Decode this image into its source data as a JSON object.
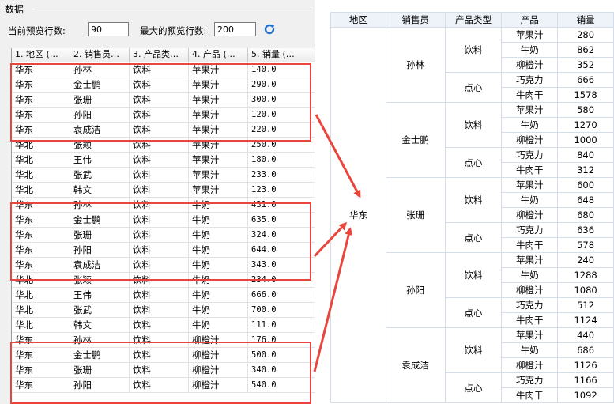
{
  "panel": {
    "title": "数据",
    "current_preview_label": "当前预览行数:",
    "current_preview_value": "90",
    "max_preview_label": "最大的预览行数:",
    "max_preview_value": "200",
    "refresh_icon": "refresh-icon",
    "headers": [
      "1. 地区 (…",
      "2. 销售员…",
      "3. 产品类…",
      "4. 产品 (…",
      "5. 销量 (…"
    ],
    "rows": [
      [
        "华东",
        "孙林",
        "饮料",
        "苹果汁",
        "140.0"
      ],
      [
        "华东",
        "金士鹏",
        "饮料",
        "苹果汁",
        "290.0"
      ],
      [
        "华东",
        "张珊",
        "饮料",
        "苹果汁",
        "300.0"
      ],
      [
        "华东",
        "孙阳",
        "饮料",
        "苹果汁",
        "120.0"
      ],
      [
        "华东",
        "袁成洁",
        "饮料",
        "苹果汁",
        "220.0"
      ],
      [
        "华北",
        "张颖",
        "饮料",
        "苹果汁",
        "250.0"
      ],
      [
        "华北",
        "王伟",
        "饮料",
        "苹果汁",
        "180.0"
      ],
      [
        "华北",
        "张武",
        "饮料",
        "苹果汁",
        "233.0"
      ],
      [
        "华北",
        "韩文",
        "饮料",
        "苹果汁",
        "123.0"
      ],
      [
        "华东",
        "孙林",
        "饮料",
        "牛奶",
        "431.0"
      ],
      [
        "华东",
        "金士鹏",
        "饮料",
        "牛奶",
        "635.0"
      ],
      [
        "华东",
        "张珊",
        "饮料",
        "牛奶",
        "324.0"
      ],
      [
        "华东",
        "孙阳",
        "饮料",
        "牛奶",
        "644.0"
      ],
      [
        "华东",
        "袁成洁",
        "饮料",
        "牛奶",
        "343.0"
      ],
      [
        "华北",
        "张颖",
        "饮料",
        "牛奶",
        "234.0"
      ],
      [
        "华北",
        "王伟",
        "饮料",
        "牛奶",
        "666.0"
      ],
      [
        "华北",
        "张武",
        "饮料",
        "牛奶",
        "700.0"
      ],
      [
        "华北",
        "韩文",
        "饮料",
        "牛奶",
        "111.0"
      ],
      [
        "华东",
        "孙林",
        "饮料",
        "柳橙汁",
        "176.0"
      ],
      [
        "华东",
        "金士鹏",
        "饮料",
        "柳橙汁",
        "500.0"
      ],
      [
        "华东",
        "张珊",
        "饮料",
        "柳橙汁",
        "340.0"
      ],
      [
        "华东",
        "孙阳",
        "饮料",
        "柳橙汁",
        "540.0"
      ]
    ]
  },
  "pivot": {
    "headers": [
      "地区",
      "销售员",
      "产品类型",
      "产品",
      "销量"
    ],
    "region": "华东",
    "sellers": [
      {
        "name": "孙林",
        "groups": [
          {
            "type": "饮料",
            "items": [
              [
                "苹果汁",
                "280"
              ],
              [
                "牛奶",
                "862"
              ],
              [
                "柳橙汁",
                "352"
              ]
            ]
          },
          {
            "type": "点心",
            "items": [
              [
                "巧克力",
                "666"
              ],
              [
                "牛肉干",
                "1578"
              ]
            ]
          }
        ]
      },
      {
        "name": "金士鹏",
        "groups": [
          {
            "type": "饮料",
            "items": [
              [
                "苹果汁",
                "580"
              ],
              [
                "牛奶",
                "1270"
              ],
              [
                "柳橙汁",
                "1000"
              ]
            ]
          },
          {
            "type": "点心",
            "items": [
              [
                "巧克力",
                "840"
              ],
              [
                "牛肉干",
                "312"
              ]
            ]
          }
        ]
      },
      {
        "name": "张珊",
        "groups": [
          {
            "type": "饮料",
            "items": [
              [
                "苹果汁",
                "600"
              ],
              [
                "牛奶",
                "648"
              ],
              [
                "柳橙汁",
                "680"
              ]
            ]
          },
          {
            "type": "点心",
            "items": [
              [
                "巧克力",
                "636"
              ],
              [
                "牛肉干",
                "578"
              ]
            ]
          }
        ]
      },
      {
        "name": "孙阳",
        "groups": [
          {
            "type": "饮料",
            "items": [
              [
                "苹果汁",
                "240"
              ],
              [
                "牛奶",
                "1288"
              ],
              [
                "柳橙汁",
                "1080"
              ]
            ]
          },
          {
            "type": "点心",
            "items": [
              [
                "巧克力",
                "512"
              ],
              [
                "牛肉干",
                "1124"
              ]
            ]
          }
        ]
      },
      {
        "name": "袁成洁",
        "groups": [
          {
            "type": "饮料",
            "items": [
              [
                "苹果汁",
                "440"
              ],
              [
                "牛奶",
                "686"
              ],
              [
                "柳橙汁",
                "1126"
              ]
            ]
          },
          {
            "type": "点心",
            "items": [
              [
                "巧克力",
                "1166"
              ],
              [
                "牛肉干",
                "1092"
              ]
            ]
          }
        ]
      }
    ]
  },
  "colors": {
    "highlight": "#e8453c",
    "refresh": "#1f6fd1"
  }
}
